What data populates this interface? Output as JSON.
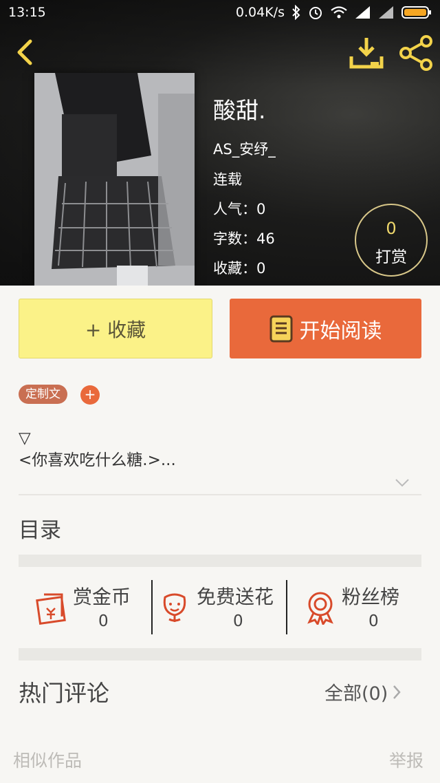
{
  "status_bar": {
    "time": "13:15",
    "network_speed": "0.04K/s",
    "battery_color": "#f5a623"
  },
  "nav": {
    "back_icon": "chevron-left-icon",
    "download_icon": "download-icon",
    "share_icon": "share-icon",
    "accent": "#f3d34a"
  },
  "book": {
    "title": "酸甜.",
    "author": "AS_安纾_",
    "status": "连载",
    "popularity_label": "人气：",
    "popularity_value": "0",
    "words_label": "字数：",
    "words_value": "46",
    "favorites_label": "收藏：",
    "favorites_value": "0"
  },
  "tip": {
    "count": "0",
    "label": "打赏"
  },
  "actions": {
    "collect_label": "+ 收藏",
    "read_label": "开始阅读",
    "read_color": "#e9693b",
    "collect_color": "#fbf288"
  },
  "tags": {
    "custom": "定制文",
    "add": "+"
  },
  "description": {
    "line1": "▽",
    "line2": "<你喜欢吃什么糖.>..."
  },
  "toc_title": "目录",
  "stats": [
    {
      "label": "赏金币",
      "value": "0",
      "icon": "red-envelope-icon"
    },
    {
      "label": "免费送花",
      "value": "0",
      "icon": "flower-icon"
    },
    {
      "label": "粉丝榜",
      "value": "0",
      "icon": "medal-icon"
    }
  ],
  "comments": {
    "title": "热门评论",
    "all_label": "全部(0)"
  },
  "footer": {
    "similar": "相似作品",
    "report": "举报"
  }
}
